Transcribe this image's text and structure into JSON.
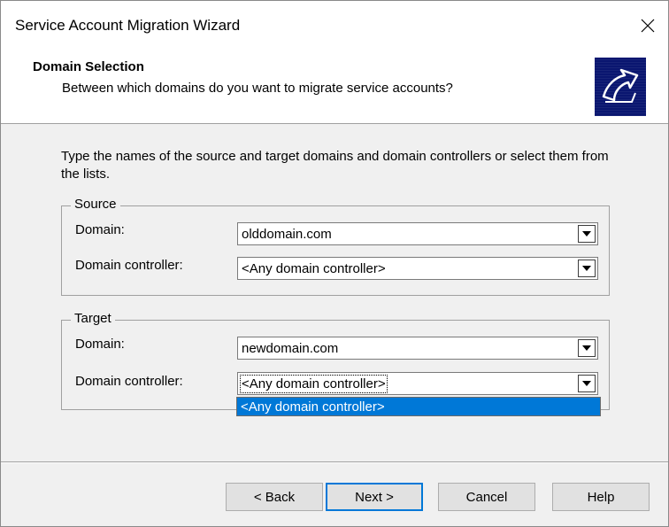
{
  "window": {
    "title": "Service Account Migration Wizard"
  },
  "header": {
    "title": "Domain Selection",
    "subtitle": "Between which domains do you want to migrate service accounts?"
  },
  "instructions": "Type the names of the source and target domains and domain controllers or select them from the lists.",
  "source": {
    "legend": "Source",
    "domain_label": "Domain:",
    "domain_value": "olddomain.com",
    "dc_label": "Domain controller:",
    "dc_value": "<Any domain controller>"
  },
  "target": {
    "legend": "Target",
    "domain_label": "Domain:",
    "domain_value": "newdomain.com",
    "dc_label": "Domain controller:",
    "dc_value": "<Any domain controller>",
    "dc_options": [
      "<Any domain controller>"
    ]
  },
  "buttons": {
    "back": "< Back",
    "next": "Next >",
    "cancel": "Cancel",
    "help": "Help"
  },
  "icons": {
    "close": "close-icon",
    "wizard": "wizard-graphic-icon",
    "dropdown": "chevron-down-icon"
  },
  "colors": {
    "selection": "#0078d7",
    "wizard_icon_bg": "#0a1670",
    "default_button_border": "#0078d7"
  }
}
